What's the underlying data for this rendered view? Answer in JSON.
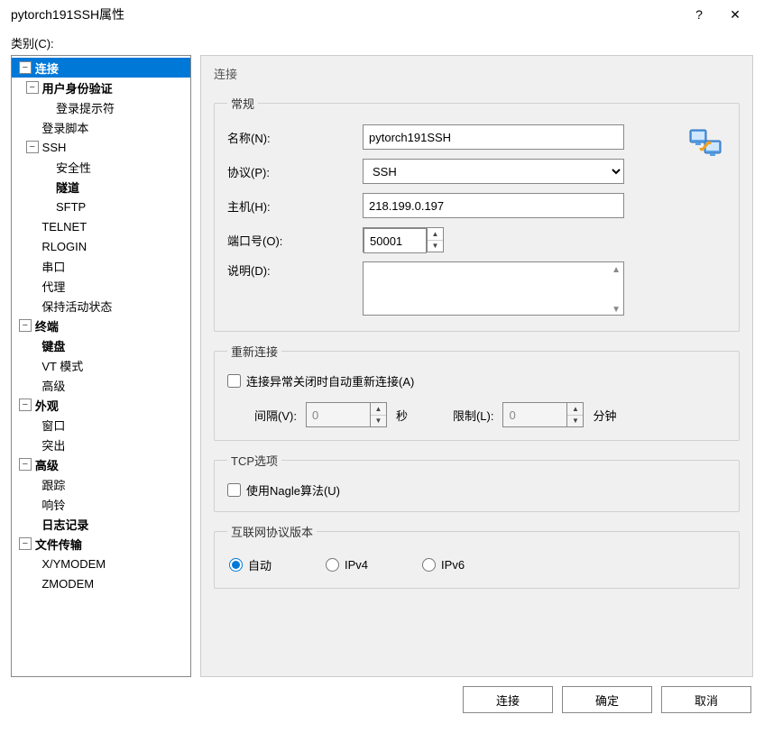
{
  "window": {
    "title": "pytorch191SSH属性",
    "help": "?",
    "close": "✕"
  },
  "category_label": "类别(C):",
  "tree": {
    "connection": "连接",
    "user_auth": "用户身份验证",
    "login_prompt": "登录提示符",
    "login_script": "登录脚本",
    "ssh": "SSH",
    "security": "安全性",
    "tunnel": "隧道",
    "sftp": "SFTP",
    "telnet": "TELNET",
    "rlogin": "RLOGIN",
    "serial": "串口",
    "proxy": "代理",
    "keepalive": "保持活动状态",
    "terminal": "终端",
    "keyboard": "键盘",
    "vt_mode": "VT 模式",
    "advanced_term": "高级",
    "appearance": "外观",
    "window": "窗口",
    "highlight": "突出",
    "advanced": "高级",
    "tracking": "跟踪",
    "bell": "响铃",
    "logging": "日志记录",
    "file_transfer": "文件传输",
    "xymodem": "X/YMODEM",
    "zmodem": "ZMODEM"
  },
  "panel": {
    "header": "连接",
    "general": {
      "legend": "常规",
      "name_label": "名称(N):",
      "name_value": "pytorch191SSH",
      "protocol_label": "协议(P):",
      "protocol_value": "SSH",
      "host_label": "主机(H):",
      "host_value": "218.199.0.197",
      "port_label": "端口号(O):",
      "port_value": "50001",
      "desc_label": "说明(D):",
      "desc_value": ""
    },
    "reconnect": {
      "legend": "重新连接",
      "auto_label": "连接异常关闭时自动重新连接(A)",
      "interval_label": "间隔(V):",
      "interval_value": "0",
      "interval_unit": "秒",
      "limit_label": "限制(L):",
      "limit_value": "0",
      "limit_unit": "分钟"
    },
    "tcp": {
      "legend": "TCP选项",
      "nagle_label": "使用Nagle算法(U)"
    },
    "ipver": {
      "legend": "互联网协议版本",
      "auto": "自动",
      "ipv4": "IPv4",
      "ipv6": "IPv6"
    }
  },
  "buttons": {
    "connect": "连接",
    "ok": "确定",
    "cancel": "取消"
  }
}
